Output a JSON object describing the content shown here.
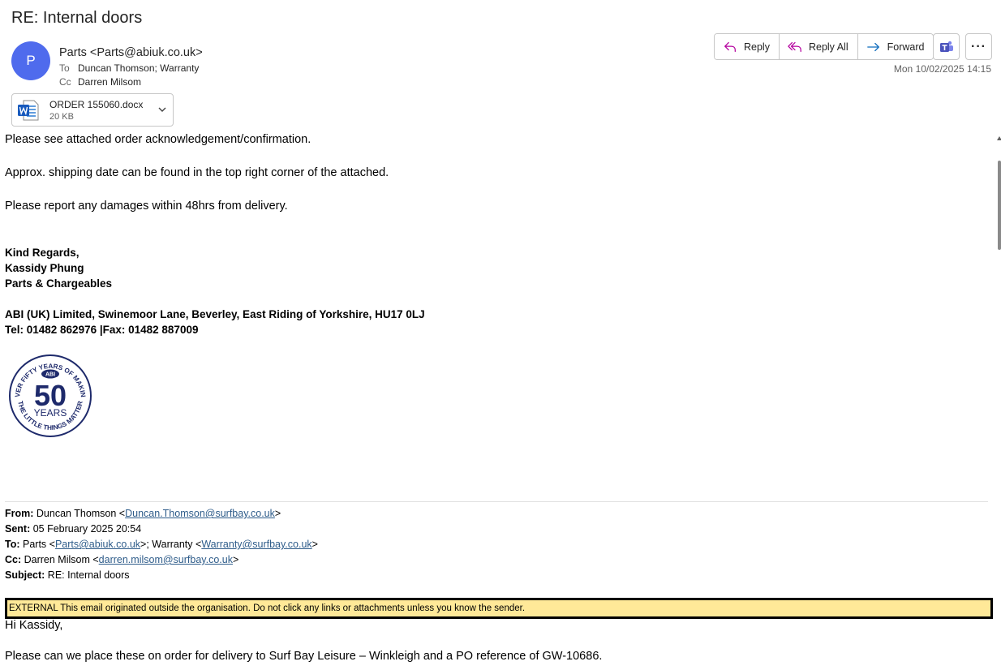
{
  "email": {
    "subject": "RE: Internal doors",
    "avatar_letter": "P",
    "sender": "Parts <Parts@abiuk.co.uk>",
    "to_label": "To",
    "to_value": "Duncan Thomson; Warranty",
    "cc_label": "Cc",
    "cc_value": "Darren Milsom",
    "date": "Mon 10/02/2025 14:15",
    "actions": {
      "reply": "Reply",
      "reply_all": "Reply All",
      "forward": "Forward",
      "more": "···"
    },
    "attachment": {
      "name": "ORDER 155060.docx",
      "size": "20 KB",
      "icon": "word-doc-icon"
    }
  },
  "body": {
    "line1": "Please see attached order acknowledgement/confirmation.",
    "line2": "Approx. shipping date can be found in the top right corner of the attached.",
    "line3": "Please report any damages within 48hrs from delivery.",
    "sig1": "Kind Regards,",
    "sig2": "Kassidy Phung",
    "sig3": "Parts & Chargeables",
    "address": "ABI (UK) Limited, Swinemoor Lane, Beverley, East Riding of Yorkshire, HU17 0LJ",
    "phone": "Tel: 01482 862976 |Fax: 01482 887009",
    "logo": {
      "brand": "ABI",
      "number": "50",
      "years": "YEARS",
      "ring_top": "OVER FIFTY YEARS OF MAKING",
      "ring_bottom": "THE LITTLE THINGS MATTER"
    }
  },
  "quoted": {
    "from_label": "From:",
    "from_name": " Duncan Thomson <",
    "from_email": "Duncan.Thomson@surfbay.co.uk",
    "from_end": ">",
    "sent_label": "Sent:",
    "sent_value": " 05 February 2025 20:54",
    "to_label": "To:",
    "to_pre": " Parts <",
    "to_email1": "Parts@abiuk.co.uk",
    "to_mid": ">; Warranty <",
    "to_email2": "Warranty@surfbay.co.uk",
    "to_end": ">",
    "cc_label": "Cc:",
    "cc_pre": " Darren Milsom <",
    "cc_email": "darren.milsom@surfbay.co.uk",
    "cc_end": ">",
    "subject_label": "Subject:",
    "subject_value": " RE: Internal doors",
    "banner": "EXTERNAL This email originated outside the organisation. Do not click any links or attachments unless you know the sender.",
    "greeting": "Hi Kassidy,",
    "line1": "Please can we place these on order for delivery to Surf Bay Leisure – Winkleigh and a PO reference of GW-10686."
  },
  "colors": {
    "avatar": "#4f6bed",
    "banner": "#ffe998",
    "link": "#2e5c8a",
    "reply_icon": "#b4009e",
    "forward_icon": "#0f6cbd",
    "teams": "#4b53bc"
  }
}
